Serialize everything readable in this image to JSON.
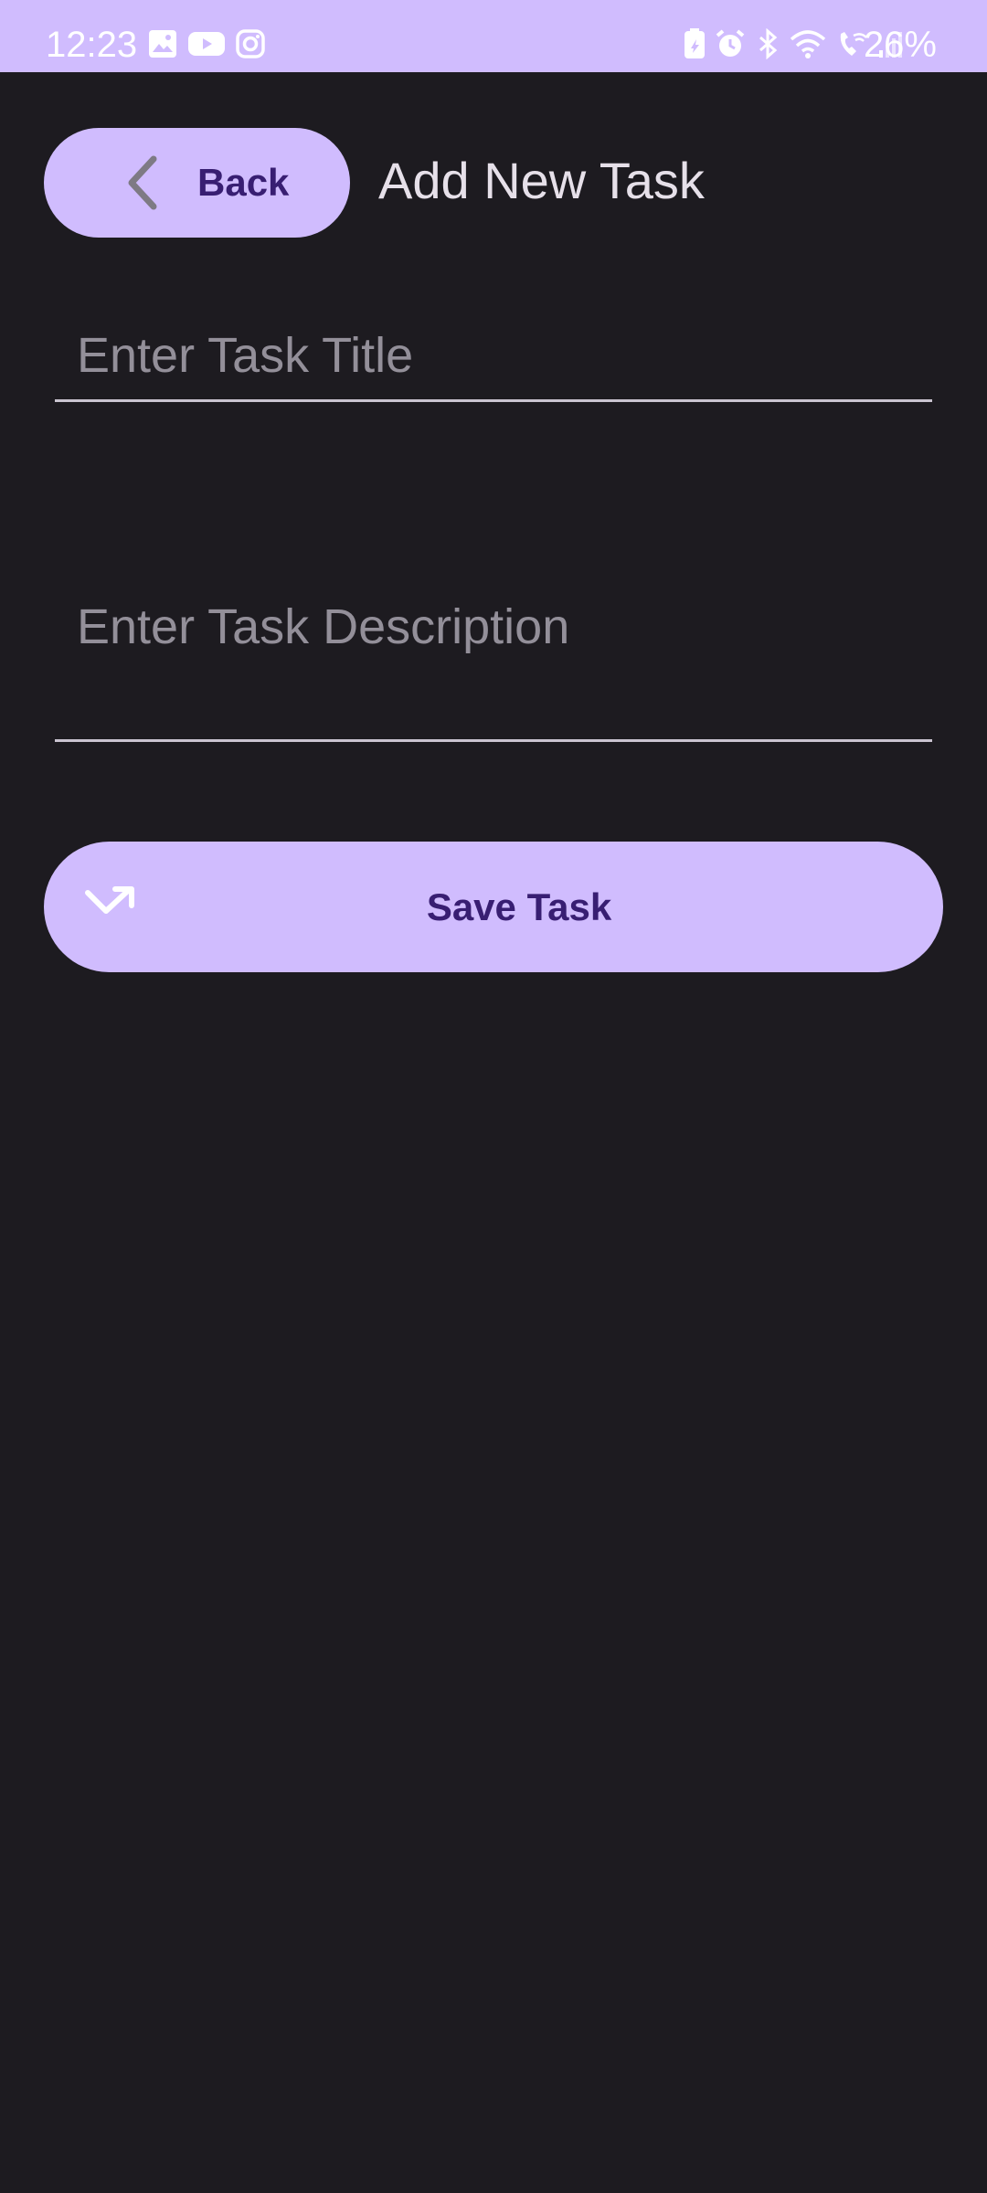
{
  "status_bar": {
    "time": "12:23",
    "battery_percent": "26%",
    "left_icons": [
      "gallery-icon",
      "youtube-icon",
      "instagram-icon"
    ],
    "right_icons": [
      "battery-saver-icon",
      "alarm-icon",
      "bluetooth-icon",
      "wifi-icon",
      "wifi-calling-icon",
      "signal-icon",
      "battery-icon"
    ]
  },
  "header": {
    "back_label": "Back",
    "title": "Add New Task"
  },
  "form": {
    "title_placeholder": "Enter Task Title",
    "title_value": "",
    "description_placeholder": "Enter Task Description",
    "description_value": "",
    "save_label": "Save Task"
  },
  "colors": {
    "background": "#1d1b20",
    "accent": "#d0bcfe",
    "on_accent": "#381e72",
    "text": "#e6e0e9",
    "placeholder": "#938f99",
    "underline": "#cac4d0"
  }
}
